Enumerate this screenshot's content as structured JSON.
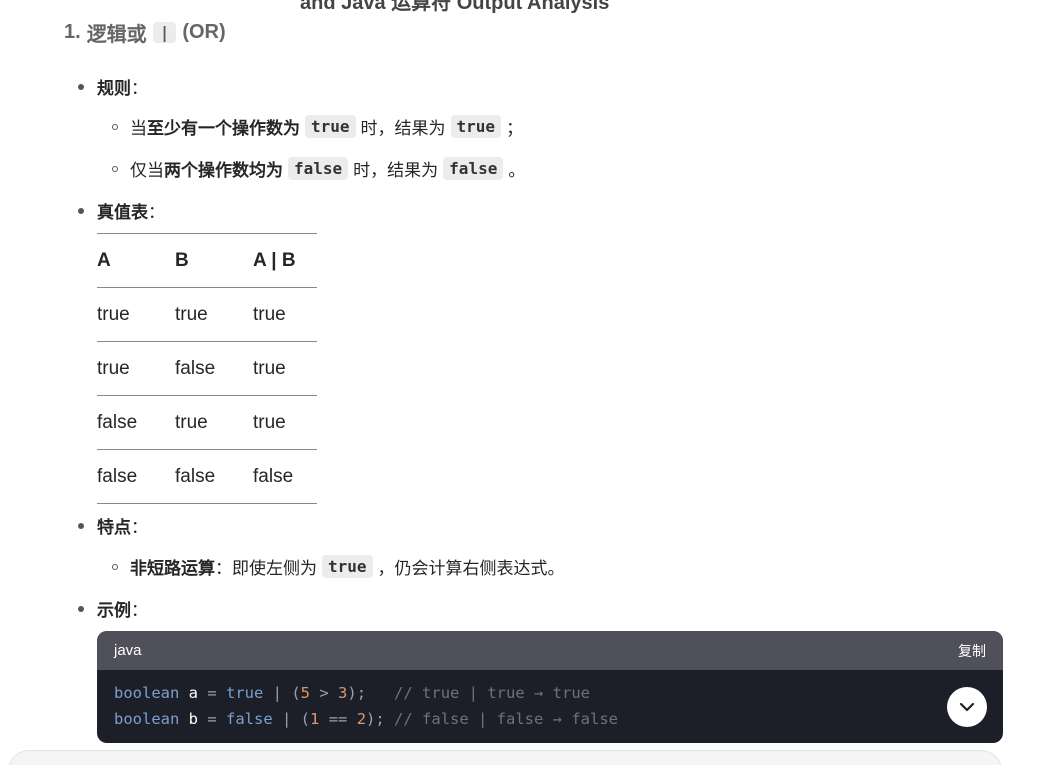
{
  "heading_cut": "and Java 运算符 Output Analysis",
  "section": {
    "number": "1.",
    "title": "逻辑或",
    "operator": "|",
    "suffix": "(OR)"
  },
  "rules": {
    "label": "规则",
    "item1": {
      "prefix": "当",
      "bold": "至少有一个操作数为",
      "code1": "true",
      "mid": "时，结果为",
      "code2": "true",
      "end": "；"
    },
    "item2": {
      "prefix": "仅当",
      "bold": "两个操作数均为",
      "code1": "false",
      "mid": "时，结果为",
      "code2": "false",
      "end": "。"
    }
  },
  "truth_table": {
    "label": "真值表",
    "headers": [
      "A",
      "B",
      "A | B"
    ],
    "rows": [
      [
        "true",
        "true",
        "true"
      ],
      [
        "true",
        "false",
        "true"
      ],
      [
        "false",
        "true",
        "true"
      ],
      [
        "false",
        "false",
        "false"
      ]
    ]
  },
  "features": {
    "label": "特点",
    "item": {
      "bold": "非短路运算",
      "text1": "：即使左侧为",
      "code": "true",
      "text2": "，仍会计算右侧表达式。"
    }
  },
  "example": {
    "label": "示例",
    "lang": "java",
    "copy": "复制",
    "line1": {
      "type": "boolean",
      "var": "a",
      "eq": " = ",
      "lhs": "true",
      "op": " | (",
      "n1": "5",
      "gt": " > ",
      "n2": "3",
      "close": ");   ",
      "comment": "// true | true → true"
    },
    "line2": {
      "type": "boolean",
      "var": "b",
      "eq": " = ",
      "lhs": "false",
      "op": " | (",
      "n1": "1",
      "gt": " == ",
      "n2": "2",
      "close": "); ",
      "comment": "// false | false → false"
    }
  },
  "colon": "："
}
